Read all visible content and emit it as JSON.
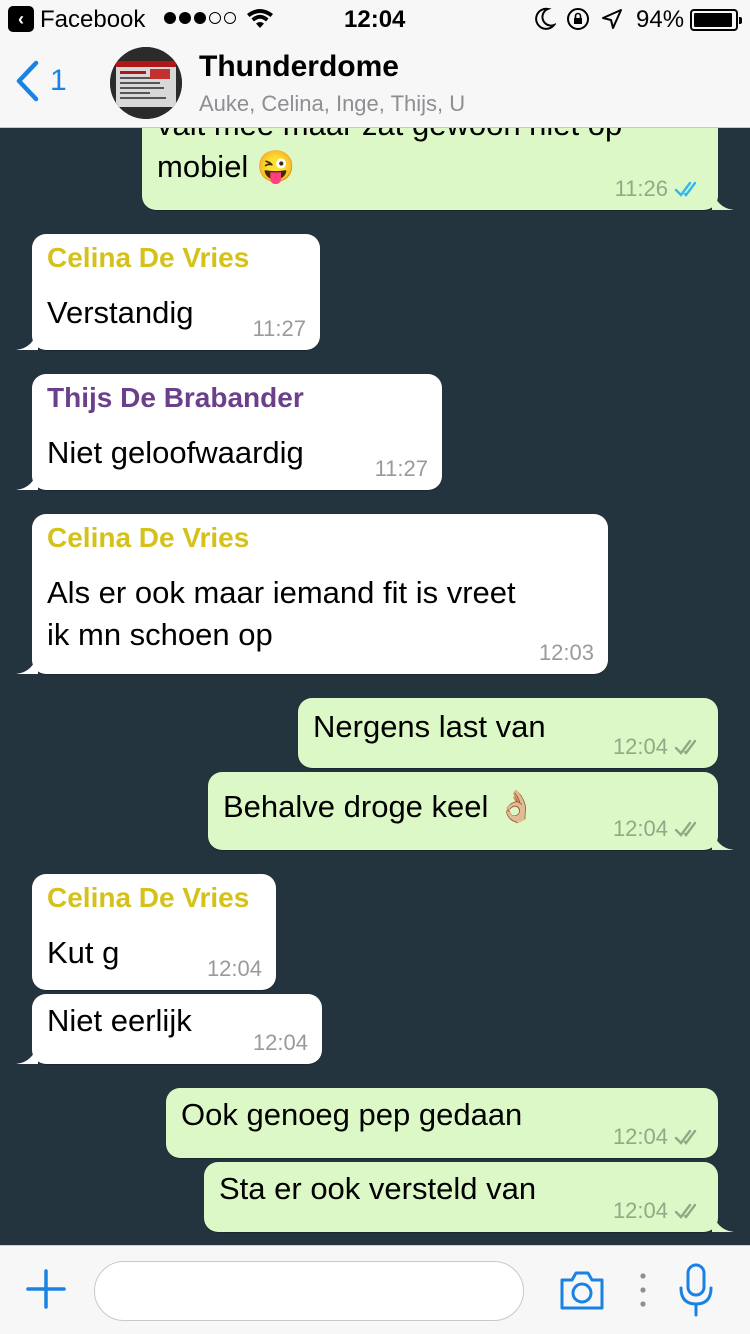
{
  "status_bar": {
    "back_app": "Facebook",
    "time": "12:04",
    "battery": "94%",
    "battery_level": 0.94,
    "signal_bars": 3,
    "signal_total": 5
  },
  "header": {
    "back_count": "1",
    "title": "Thunderdome",
    "subtitle": "Auke, Celina, Inge, Thijs, U"
  },
  "colors": {
    "accent": "#1a82e2",
    "celina": "#d4c21a",
    "thijs": "#6b3f8a",
    "outgoing_bubble": "#dcf8c6",
    "chat_background": "#24343e"
  },
  "messages": [
    {
      "direction": "out",
      "text_lines": [
        "valt mee maar zat gewoon niet op",
        "mobiel 😜"
      ],
      "time": "11:26",
      "read": true
    },
    {
      "direction": "in",
      "sender": "Celina De Vries",
      "text_lines": [
        "Verstandig"
      ],
      "time": "11:27"
    },
    {
      "direction": "in",
      "sender": "Thijs De Brabander",
      "text_lines": [
        "Niet geloofwaardig"
      ],
      "time": "11:27"
    },
    {
      "direction": "in",
      "sender": "Celina De Vries",
      "text_lines": [
        "Als er ook maar iemand fit is vreet",
        "ik mn schoen op"
      ],
      "time": "12:03"
    },
    {
      "direction": "out",
      "text_lines": [
        "Nergens last van"
      ],
      "time": "12:04",
      "read": false
    },
    {
      "direction": "out",
      "text_lines": [
        "Behalve droge keel 👌🏼"
      ],
      "time": "12:04",
      "read": false
    },
    {
      "direction": "in",
      "sender": "Celina De Vries",
      "text_lines": [
        "Kut g"
      ],
      "time": "12:04"
    },
    {
      "direction": "in",
      "text_lines": [
        "Niet eerlijk"
      ],
      "time": "12:04"
    },
    {
      "direction": "out",
      "text_lines": [
        "Ook genoeg pep gedaan"
      ],
      "time": "12:04",
      "read": false
    },
    {
      "direction": "out",
      "text_lines": [
        "Sta er ook versteld van"
      ],
      "time": "12:04",
      "read": false
    }
  ],
  "composer": {
    "value": "",
    "placeholder": ""
  },
  "icons": {
    "plus": "plus-icon",
    "camera": "camera-icon",
    "more": "more-dots-icon",
    "mic": "microphone-icon"
  }
}
